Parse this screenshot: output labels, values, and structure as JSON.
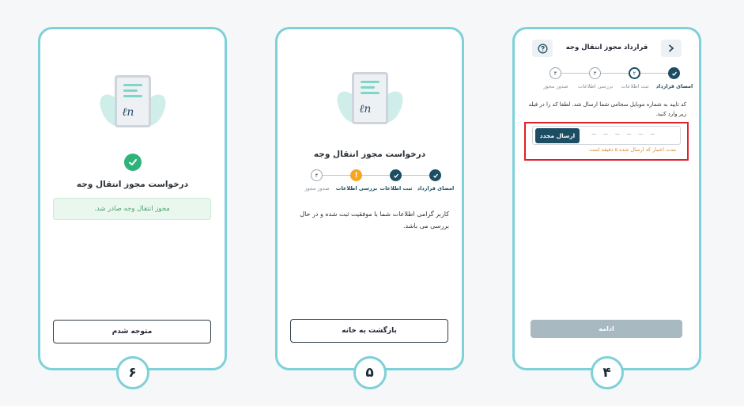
{
  "screens": {
    "s6": {
      "step_number": "۶",
      "title": "درخواست مجوز انتقال وجه",
      "success_message": "مجوز انتقال وجه صادر شد.",
      "button_label": "متوجه شدم"
    },
    "s5": {
      "step_number": "۵",
      "title": "درخواست مجوز انتقال وجه",
      "steps": [
        {
          "num": "",
          "label": "امضای قرارداد",
          "state": "done"
        },
        {
          "num": "",
          "label": "ثبت اطلاعات",
          "state": "done"
        },
        {
          "num": "!",
          "label": "بررسی اطلاعات",
          "state": "warn"
        },
        {
          "num": "۴",
          "label": "صدور مجوز",
          "state": "todo"
        }
      ],
      "message": "کاربر گرامی اطلاعات شما با موفقیت ثبت شده و در حال بررسی می باشد.",
      "button_label": "بازگشت به خانه"
    },
    "s4": {
      "step_number": "۴",
      "header_title": "قرارداد مجوز انتقال وجه",
      "steps": [
        {
          "num": "",
          "label": "امضای قرارداد",
          "state": "done"
        },
        {
          "num": "۲",
          "label": "ثبت اطلاعات",
          "state": "active"
        },
        {
          "num": "۳",
          "label": "بررسی اطلاعات",
          "state": "todo"
        },
        {
          "num": "۴",
          "label": "صدور مجوز",
          "state": "todo"
        }
      ],
      "instruction": "کد تایید به شماره موبایل سجامی شما ارسال شد. لطفا کد را در فیلد زیر وارد کنید.",
      "otp_placeholder": "— — — — — —",
      "resend_label": "ارسال مجدد",
      "otp_hint": "مدت اعتبار کد ارسال شده ۵ دقیقه است",
      "continue_label": "ادامه"
    }
  },
  "colors": {
    "frame": "#7ed0d9",
    "primary": "#1d4d63",
    "success": "#2fb37b",
    "warning": "#f5a623",
    "highlight": "#e0202a"
  }
}
